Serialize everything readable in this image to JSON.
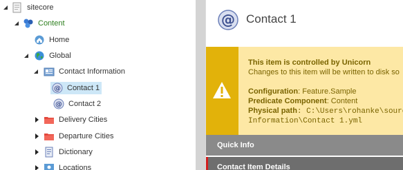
{
  "tree": {
    "items": [
      {
        "label": "sitecore",
        "icon": "sitecore-root-icon",
        "expanded": true,
        "level": 0
      },
      {
        "label": "Content",
        "icon": "content-icon",
        "expanded": true,
        "level": 1,
        "color": "#2d7f1e"
      },
      {
        "label": "Home",
        "icon": "home-icon",
        "level": 2
      },
      {
        "label": "Global",
        "icon": "globe-icon",
        "expanded": true,
        "level": 2
      },
      {
        "label": "Contact Information",
        "icon": "folder-card-icon",
        "expanded": true,
        "level": 3
      },
      {
        "label": "Contact 1",
        "icon": "at-sign-icon",
        "level": 4,
        "selected": true
      },
      {
        "label": "Contact 2",
        "icon": "at-sign-icon",
        "level": 4
      },
      {
        "label": "Delivery Cities",
        "icon": "red-folder-icon",
        "expanded": false,
        "level": 3
      },
      {
        "label": "Departure Cities",
        "icon": "red-folder-icon",
        "expanded": false,
        "level": 3
      },
      {
        "label": "Dictionary",
        "icon": "dictionary-icon",
        "expanded": false,
        "level": 3
      },
      {
        "label": "Locations",
        "icon": "locations-icon",
        "expanded": false,
        "level": 3
      }
    ]
  },
  "item": {
    "title": "Contact 1",
    "icon": "at-sign-icon"
  },
  "warning": {
    "title": "This item is controlled by Unicorn",
    "subtitle": "Changes to this item will be written to disk so",
    "configuration_label": "Configuration",
    "configuration_value": ": Feature.Sample",
    "predicate_label": "Predicate Component",
    "predicate_value": ": Content",
    "path_label": "Physical path",
    "path_value_1": ": C:\\Users\\rohanke\\source\\r",
    "path_value_2": "Information\\Contact 1.yml",
    "colors": {
      "sidebar": "#e2b20a",
      "background": "#fde8a5"
    }
  },
  "sections": {
    "quick_info": "Quick Info",
    "contact_details": "Contact Item Details"
  }
}
